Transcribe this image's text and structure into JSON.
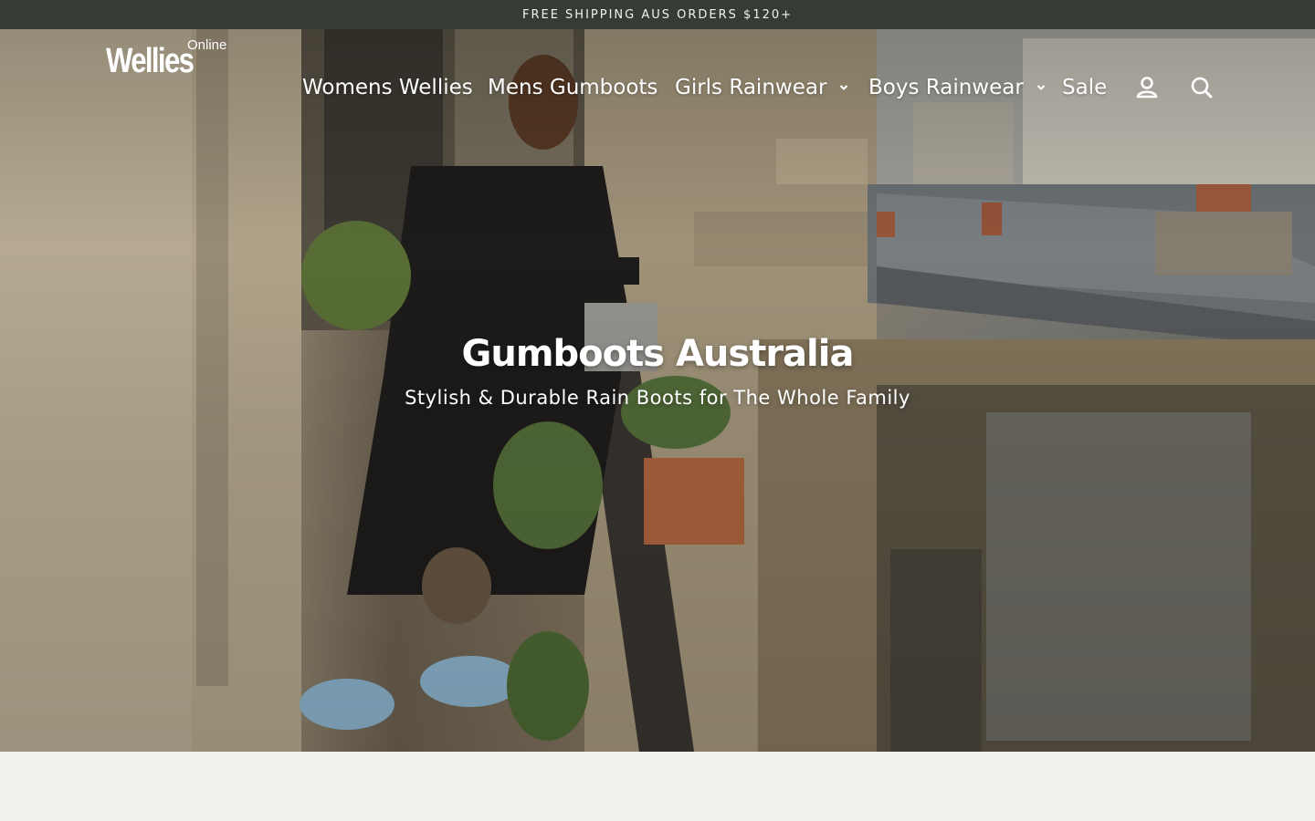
{
  "announcement": {
    "text": "FREE SHIPPING AUS ORDERS $120+"
  },
  "logo": {
    "main": "Wellies",
    "sub": "Online"
  },
  "nav": {
    "items": [
      {
        "label": "Womens Wellies",
        "has_dropdown": false
      },
      {
        "label": "Mens Gumboots",
        "has_dropdown": false
      },
      {
        "label": "Girls Rainwear",
        "has_dropdown": true
      },
      {
        "label": "Boys Rainwear",
        "has_dropdown": true
      },
      {
        "label": "Sale",
        "has_dropdown": false
      }
    ],
    "icons": [
      "account-icon",
      "search-icon"
    ]
  },
  "hero": {
    "title": "Gumboots Australia",
    "subtitle": "Stylish & Durable Rain Boots for The Whole Family"
  },
  "colors": {
    "announcement_bg": "#353c35",
    "announcement_text": "#f2f2ec",
    "nav_text": "#ffffff",
    "page_bg": "#f2f1ee"
  }
}
